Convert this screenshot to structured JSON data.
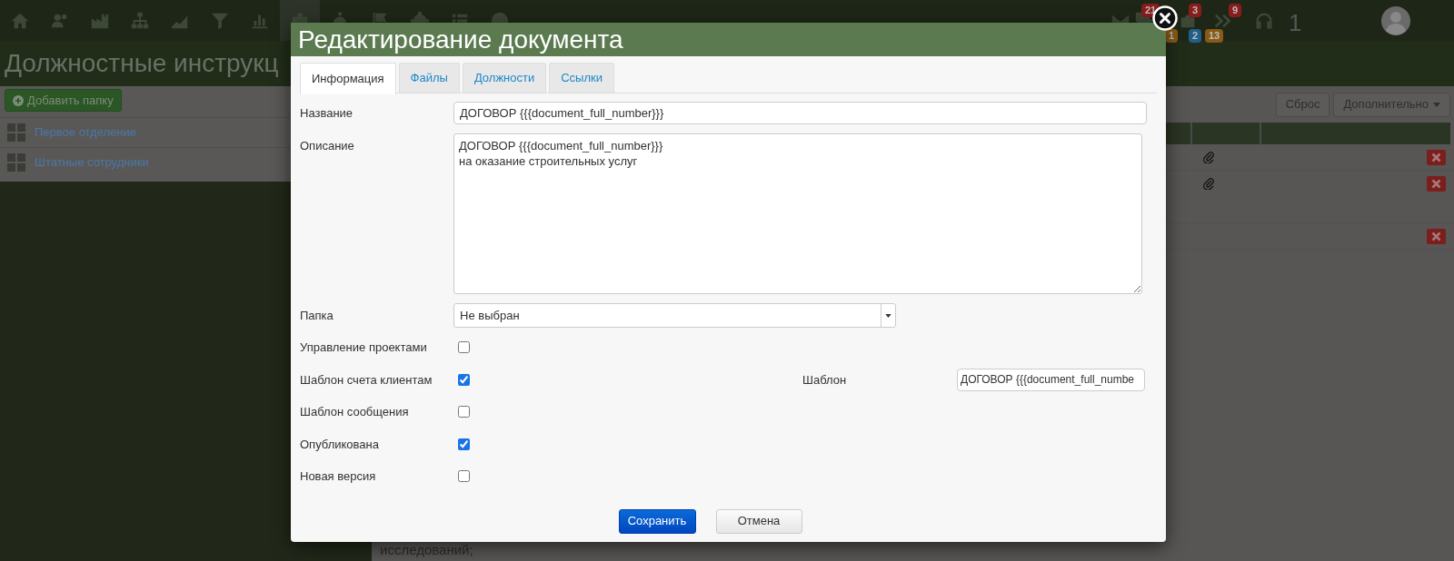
{
  "top_nav": {
    "badges": [
      {
        "text": "21",
        "color": "#8a1c1c"
      },
      {
        "text": "3",
        "color": "#8a1c1c"
      },
      {
        "text": "9",
        "color": "#8a1c1c"
      },
      {
        "text": "1",
        "color": "#8a5a14"
      },
      {
        "text": "2",
        "color": "#1f5f8a"
      },
      {
        "text": "13",
        "color": "#8a5a14"
      }
    ],
    "counter": "1"
  },
  "page": {
    "title": "Должностные инструкц",
    "add_button": "Добавить папку",
    "folders": [
      {
        "label": "Первое отделение"
      },
      {
        "label": "Штатные сотрудники"
      }
    ],
    "toolbar": {
      "reset": "Сброс",
      "more": "Дополнительно"
    },
    "rows": [
      {
        "attachment": true
      },
      {
        "attachment": true
      },
      {
        "attachment": false
      }
    ],
    "content_line": "исследований;"
  },
  "modal": {
    "title": "Редактирование документа",
    "tabs": [
      {
        "label": "Информация",
        "selected": true
      },
      {
        "label": "Файлы",
        "selected": false
      },
      {
        "label": "Должности",
        "selected": false
      },
      {
        "label": "Ссылки",
        "selected": false
      }
    ],
    "name": {
      "label": "Название",
      "value": "ДОГОВОР {{{document_full_number}}}"
    },
    "description": {
      "label": "Описание",
      "value": "ДОГОВОР {{{document_full_number}}}\nна оказание строительных услуг"
    },
    "folder": {
      "label": "Папка",
      "value": "Не выбран"
    },
    "checkboxes": [
      {
        "label": "Управление проектами",
        "checked": false
      },
      {
        "label": "Шаблон счета клиентам",
        "checked": true,
        "template": {
          "label": "Шаблон",
          "value": "ДОГОВОР {{{document_full_numbe"
        }
      },
      {
        "label": "Шаблон сообщения",
        "checked": false
      },
      {
        "label": "Опубликована",
        "checked": true
      },
      {
        "label": "Новая версия",
        "checked": false
      }
    ],
    "buttons": [
      {
        "label": "Сохранить",
        "kind": "primary"
      },
      {
        "label": "Отмена",
        "kind": "default"
      }
    ]
  }
}
